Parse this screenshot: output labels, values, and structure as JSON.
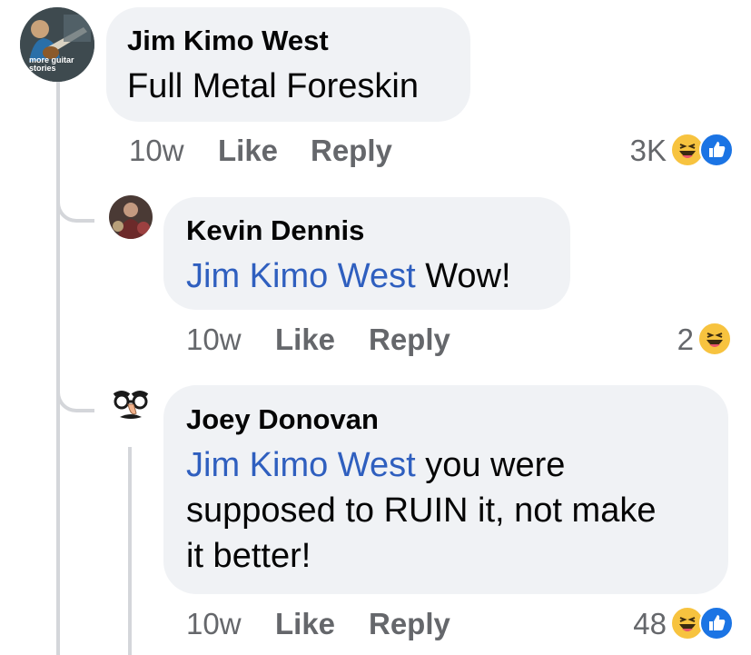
{
  "comments": [
    {
      "author": "Jim Kimo West",
      "text": "Full Metal Foreskin",
      "avatar_text": "more guitar stories",
      "time": "10w",
      "like_label": "Like",
      "reply_label": "Reply",
      "reaction_count": "3K",
      "reactions": [
        "haha-icon",
        "like-icon"
      ]
    },
    {
      "author": "Kevin Dennis",
      "mention": "Jim Kimo West",
      "text": " Wow!",
      "time": "10w",
      "like_label": "Like",
      "reply_label": "Reply",
      "reaction_count": "2",
      "reactions": [
        "haha-icon"
      ]
    },
    {
      "author": "Joey Donovan",
      "mention": "Jim Kimo West",
      "text_line1": " you were",
      "text_line2": "supposed to RUIN it, not make",
      "text_line3": "it better!",
      "time": "10w",
      "like_label": "Like",
      "reply_label": "Reply",
      "reaction_count": "48",
      "reactions": [
        "haha-icon",
        "like-icon"
      ]
    }
  ],
  "colors": {
    "bubble": "#f0f2f5",
    "mention": "#2f5fbf",
    "meta": "#65676b",
    "haha": "#f7c33f",
    "like": "#1b74e4",
    "thread": "#d4d6da"
  }
}
